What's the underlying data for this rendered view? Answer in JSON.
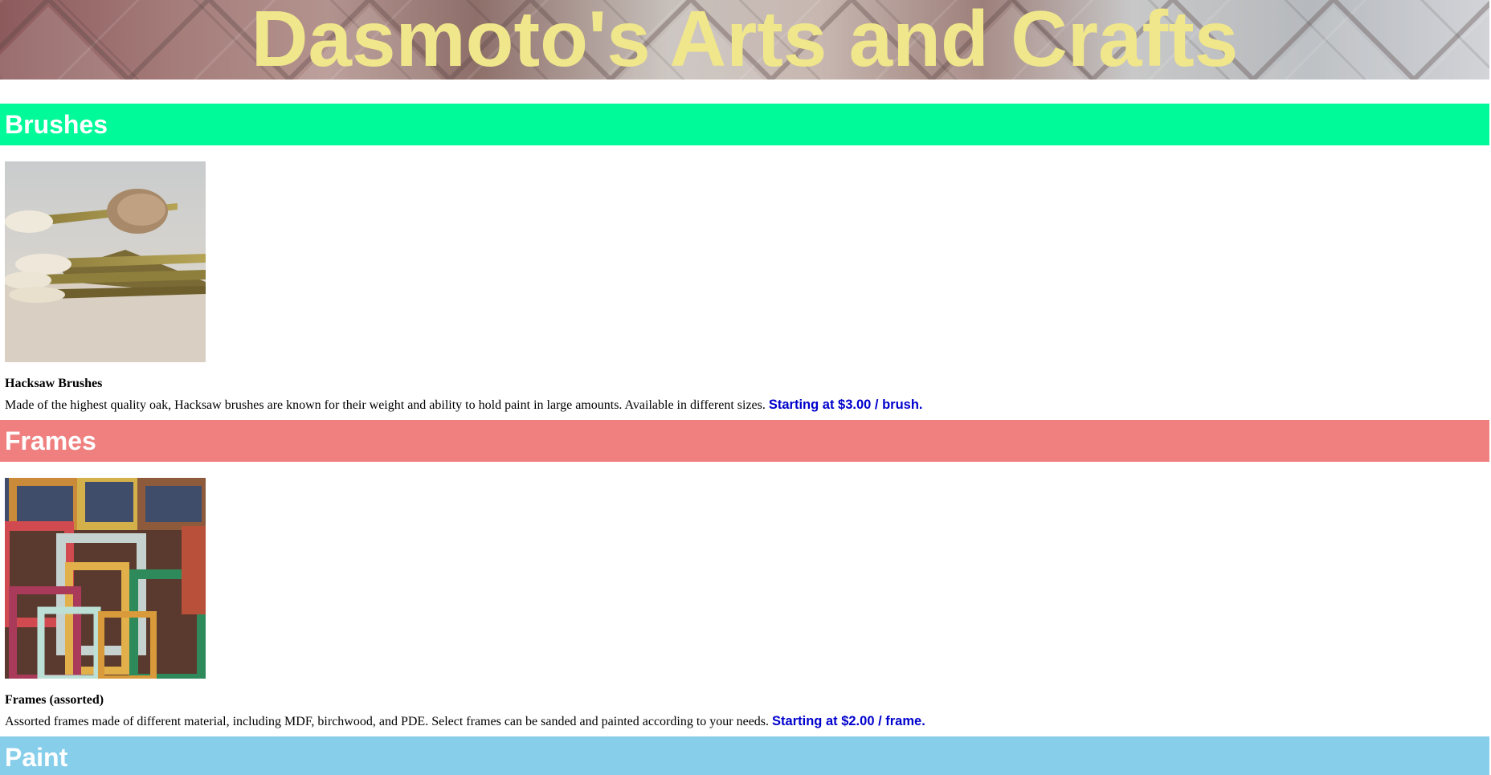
{
  "header": {
    "title": "Dasmoto's Arts and Crafts"
  },
  "sections": [
    {
      "heading": "Brushes",
      "heading_color": "#00fa9a",
      "product_name": "Hacksaw Brushes",
      "description": "Made of the highest quality oak, Hacksaw brushes are known for their weight and ability to hold paint in large amounts. Available in different sizes.",
      "price": "Starting at $3.00 / brush."
    },
    {
      "heading": "Frames",
      "heading_color": "#f08080",
      "product_name": "Frames (assorted)",
      "description": "Assorted frames made of different material, including MDF, birchwood, and PDE. Select frames can be sanded and painted according to your needs.",
      "price": "Starting at $2.00 / frame."
    },
    {
      "heading": "Paint",
      "heading_color": "#87ceeb"
    }
  ],
  "colors": {
    "title": "#f0e68c",
    "price": "#0000cd",
    "heading_text": "#ffffff"
  }
}
